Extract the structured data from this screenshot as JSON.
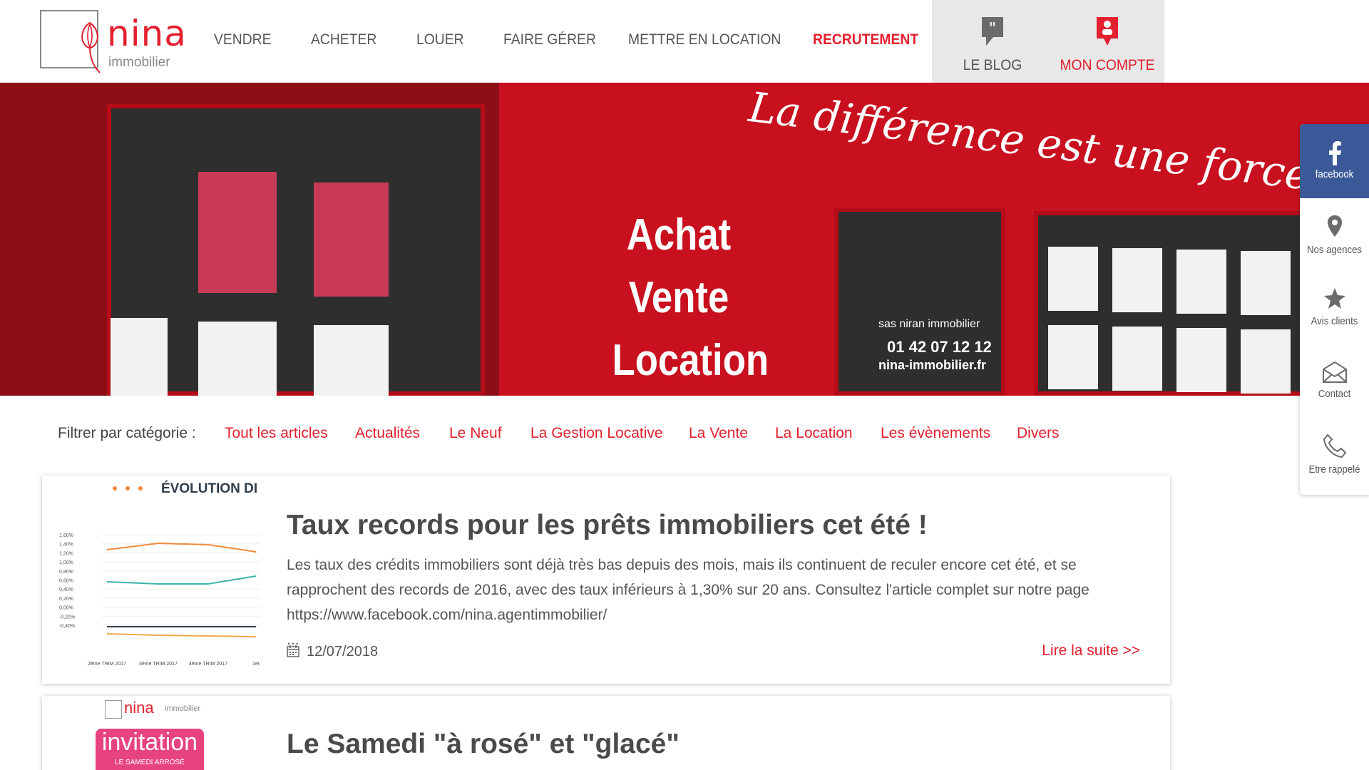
{
  "brand": {
    "name": "nina",
    "sub": "immobilier"
  },
  "nav": {
    "items": [
      "VENDRE",
      "ACHETER",
      "LOUER",
      "FAIRE GÉRER",
      "METTRE EN LOCATION",
      "RECRUTEMENT"
    ],
    "active_index": 5,
    "blog_label": "LE BLOG",
    "account_label": "MON COMPTE"
  },
  "hero": {
    "slogan": "La différence est une force",
    "lines": [
      "Achat",
      "Vente",
      "Location"
    ],
    "sign_small": [
      "sas niran immobilier",
      "01 42 07 12 12",
      "nina-immobilier.fr"
    ]
  },
  "filter": {
    "label": "Filtrer par catégorie :",
    "categories": [
      "Tout les articles",
      "Actualités",
      "Le Neuf",
      "La Gestion Locative",
      "La Vente",
      "La Location",
      "Les évènements",
      "Divers"
    ]
  },
  "articles": [
    {
      "title": "Taux records pour les prêts immobiliers cet été !",
      "body": "Les taux des crédits immobiliers sont déjà très bas depuis des mois, mais ils continuent de reculer encore cet été, et se rapprochent des records de 2016, avec des taux inférieurs à 1,30%  sur 20 ans. Consultez l'article complet sur notre page https://www.facebook.com/nina.agentimmobilier/",
      "ellipsis": "...",
      "date": "12/07/2018",
      "more": "Lire la suite >>",
      "thumb": {
        "heading": "ÉVOLUTION DI",
        "y_ticks": [
          "1,60%",
          "1,40%",
          "1,20%",
          "1,00%",
          "0,80%",
          "0,60%",
          "0,40%",
          "0,20%",
          "0,00%",
          "-0,20%",
          "-0,40%"
        ],
        "x_ticks": [
          "2ème TRIM 2017",
          "3ème TRIM 2017",
          "4ème TRIM 2017",
          "1er"
        ]
      }
    },
    {
      "title": "Le Samedi \"à rosé\" et \"glacé\"",
      "thumb": {
        "brand": "nina",
        "brand_sub": "immobilier",
        "badge": "invitation",
        "badge_sub": "LE SAMEDI ARROSÉ"
      }
    }
  ],
  "sidebar": {
    "items": [
      "facebook",
      "Nos agences",
      "Avis clients",
      "Contact",
      "Etre rappelé"
    ]
  },
  "colors": {
    "accent": "#e3202f",
    "facebook": "#3b5998",
    "hero": "#c8101e"
  }
}
